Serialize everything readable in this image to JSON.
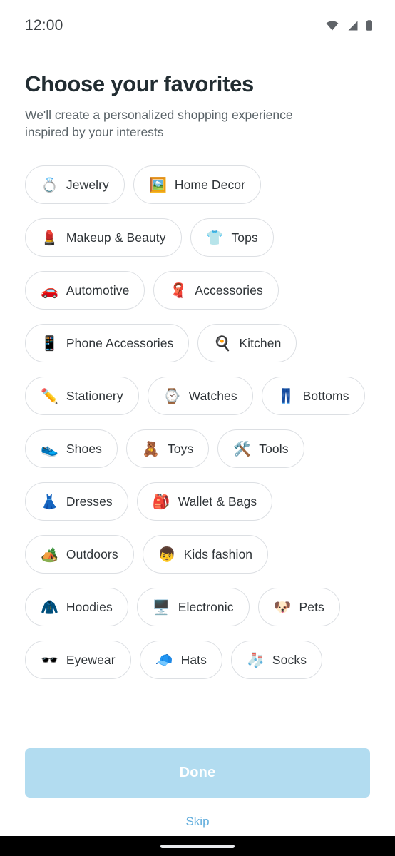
{
  "status_bar": {
    "time": "12:00",
    "icons": [
      "wifi-icon",
      "cellular-signal-icon",
      "battery-icon"
    ]
  },
  "header": {
    "title": "Choose your favorites",
    "subtitle": "We'll create a personalized shopping experience inspired by your interests"
  },
  "chips": [
    {
      "label": "Jewelry",
      "emoji": "💍",
      "icon": "ring-icon"
    },
    {
      "label": "Home Decor",
      "emoji": "🖼️",
      "icon": "framed-picture-icon"
    },
    {
      "label": "Makeup & Beauty",
      "emoji": "💄",
      "icon": "lipstick-icon"
    },
    {
      "label": "Tops",
      "emoji": "👕",
      "icon": "tshirt-icon"
    },
    {
      "label": "Automotive",
      "emoji": "🚗",
      "icon": "car-icon"
    },
    {
      "label": "Accessories",
      "emoji": "🧣",
      "icon": "scarf-icon"
    },
    {
      "label": "Phone Accessories",
      "emoji": "📱",
      "icon": "mobile-phone-icon"
    },
    {
      "label": "Kitchen",
      "emoji": "🍳",
      "icon": "cooking-pan-icon"
    },
    {
      "label": "Stationery",
      "emoji": "✏️",
      "icon": "pencil-icon"
    },
    {
      "label": "Watches",
      "emoji": "⌚",
      "icon": "watch-icon"
    },
    {
      "label": "Bottoms",
      "emoji": "👖",
      "icon": "jeans-icon"
    },
    {
      "label": "Shoes",
      "emoji": "👟",
      "icon": "sneaker-icon"
    },
    {
      "label": "Toys",
      "emoji": "🧸",
      "icon": "teddy-bear-icon"
    },
    {
      "label": "Tools",
      "emoji": "🛠️",
      "icon": "hammer-and-wrench-icon"
    },
    {
      "label": "Dresses",
      "emoji": "👗",
      "icon": "dress-icon"
    },
    {
      "label": "Wallet & Bags",
      "emoji": "🎒",
      "icon": "backpack-icon"
    },
    {
      "label": "Outdoors",
      "emoji": "🏕️",
      "icon": "camping-icon"
    },
    {
      "label": "Kids fashion",
      "emoji": "👦",
      "icon": "boy-icon"
    },
    {
      "label": "Hoodies",
      "emoji": "🧥",
      "icon": "coat-icon"
    },
    {
      "label": "Electronic",
      "emoji": "🖥️",
      "icon": "desktop-computer-icon"
    },
    {
      "label": "Pets",
      "emoji": "🐶",
      "icon": "dog-face-icon"
    },
    {
      "label": "Eyewear",
      "emoji": "🕶️",
      "icon": "sunglasses-icon"
    },
    {
      "label": "Hats",
      "emoji": "🧢",
      "icon": "billed-cap-icon"
    },
    {
      "label": "Socks",
      "emoji": "🧦",
      "icon": "socks-icon"
    }
  ],
  "actions": {
    "done_label": "Done",
    "skip_label": "Skip"
  },
  "colors": {
    "done_button_bg": "#b2dcf0",
    "done_button_text": "#ffffff",
    "skip_text": "#62aedd",
    "chip_border": "#dcdfe3",
    "title_text": "#222d32",
    "subtitle_text": "#5a6368"
  }
}
